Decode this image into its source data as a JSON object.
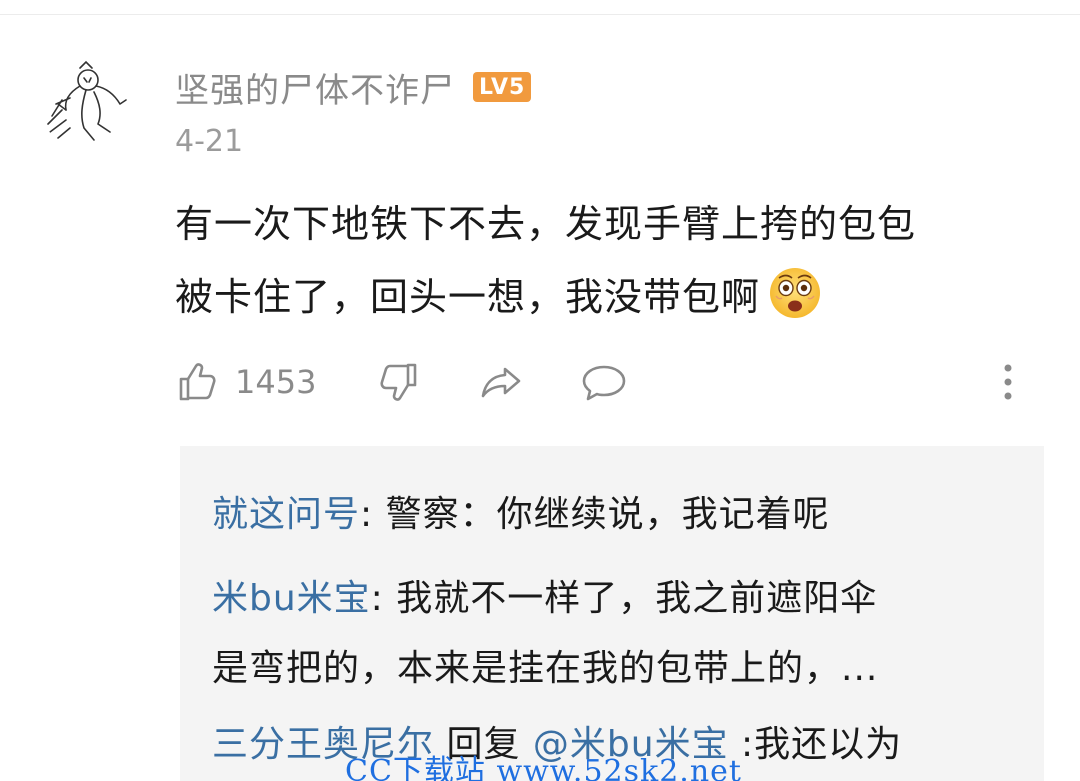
{
  "comment": {
    "username": "坚强的尸体不诈尸",
    "level": "LV5",
    "date": "4-21",
    "body_line1": "有一次下地铁下不去，发现手臂上挎的包包",
    "body_line2": "被卡住了，回头一想，我没带包啊",
    "emoji": "astonished-face-emoji",
    "like_count": "1453"
  },
  "actions": {
    "like_icon": "thumbs-up-icon",
    "dislike_icon": "thumbs-down-icon",
    "share_icon": "share-arrow-icon",
    "reply_icon": "speech-bubble-icon",
    "more_icon": "more-vertical-icon"
  },
  "replies": [
    {
      "author": "就这问号",
      "separator": ": ",
      "text": "警察：你继续说，我记着呢"
    },
    {
      "author": "米bu米宝",
      "separator": ": ",
      "text_line1": "我就不一样了，我之前遮阳伞",
      "text_line2": "是弯把的，本来是挂在我的包带上的，..."
    },
    {
      "author": "三分王奥尼尔",
      "reply_word": " 回复 ",
      "mention": "@米bu米宝",
      "text": " :我还以为"
    }
  ],
  "watermark": "CC下载站 www.52sk2.net",
  "colors": {
    "author_link": "#3a6fa3",
    "badge": "#f19a3e",
    "muted_text": "#8a8a8a",
    "reply_background": "#f4f4f4",
    "watermark": "#1f6fe0"
  }
}
